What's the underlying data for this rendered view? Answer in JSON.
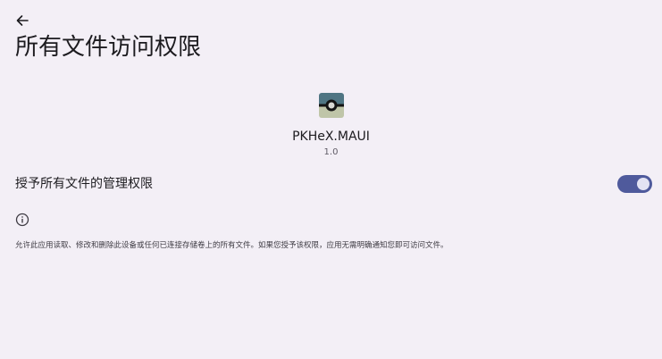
{
  "navigation": {
    "back_icon": "arrow-left-icon"
  },
  "page": {
    "title": "所有文件访问权限"
  },
  "app": {
    "icon": "app-icon-pkhex",
    "name": "PKHeX.MAUI",
    "version": "1.0"
  },
  "permission": {
    "label": "授予所有文件的管理权限",
    "enabled": true,
    "accent_color": "#4f5a9c"
  },
  "info": {
    "icon": "info-icon",
    "description": "允许此应用读取、修改和删除此设备或任何已连接存储卷上的所有文件。如果您授予该权限，应用无需明确通知您即可访问文件。"
  },
  "colors": {
    "background": "#f3eff6",
    "text_primary": "#1c1b1f",
    "text_secondary": "#5f5b66"
  }
}
